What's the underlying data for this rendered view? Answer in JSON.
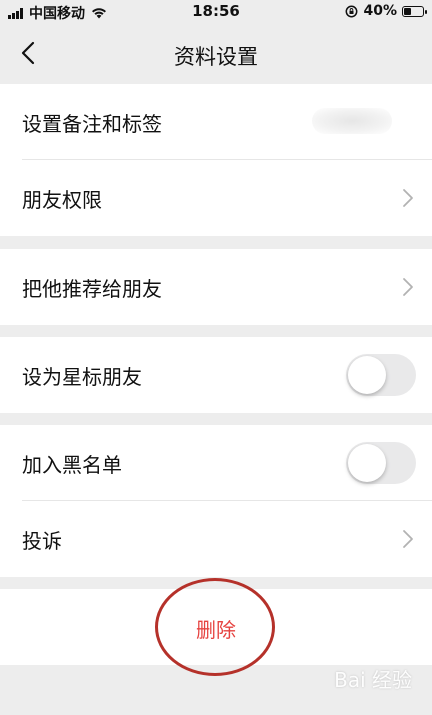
{
  "status_bar": {
    "carrier": "中国移动",
    "time": "18:56",
    "battery": "40%",
    "battery_level": 0.4
  },
  "nav": {
    "title": "资料设置"
  },
  "settings": {
    "remark": "设置备注和标签",
    "permissions": "朋友权限",
    "recommend": "把他推荐给朋友",
    "star": "设为星标朋友",
    "blacklist": "加入黑名单",
    "report": "投诉"
  },
  "toggles": {
    "star_on": false,
    "blacklist_on": false
  },
  "delete_label": "删除",
  "watermark": "Bai 经验",
  "colors": {
    "background": "#ededed",
    "delete": "#e64340",
    "highlight": "#b5312a"
  },
  "icons": {
    "back": "chevron-left-icon",
    "chevron": "chevron-right-icon",
    "wifi": "wifi-icon",
    "lock": "orientation-lock-icon"
  }
}
